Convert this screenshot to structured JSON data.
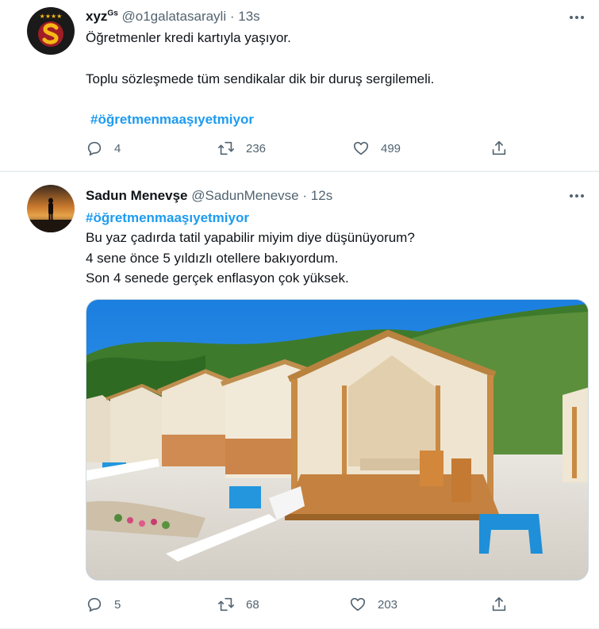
{
  "tweets": [
    {
      "display_name": "xyz",
      "name_sup": "Gs",
      "handle": "@o1galatasarayli",
      "separator": "·",
      "time": "13s",
      "lines": [
        "Öğretmenler kredi kartıyla yaşıyor.",
        "Toplu sözleşmede tüm sendikalar dik bir duruş sergilemeli.",
        "#öğretmenmaaşıyetmiyor"
      ],
      "replies": "4",
      "retweets": "236",
      "likes": "499"
    },
    {
      "display_name": "Sadun Menevşe",
      "handle": "@SadunMenevse",
      "separator": "·",
      "time": "12s",
      "lines": [
        "#öğretmenmaaşıyetmiyor",
        "Bu yaz çadırda tatil yapabilir miyim diye düşünüyorum?",
        "4 sene önce 5 yıldızlı otellere bakıyordum.",
        "Son 4 senede gerçek enflasyon çok yüksek."
      ],
      "replies": "5",
      "retweets": "68",
      "likes": "203"
    }
  ],
  "colors": {
    "accent": "#1d9bf0",
    "muted": "#536471",
    "text": "#0f1419",
    "divider": "#eff3f4"
  },
  "icons": [
    "more-icon",
    "reply-icon",
    "retweet-icon",
    "like-icon",
    "share-icon"
  ]
}
